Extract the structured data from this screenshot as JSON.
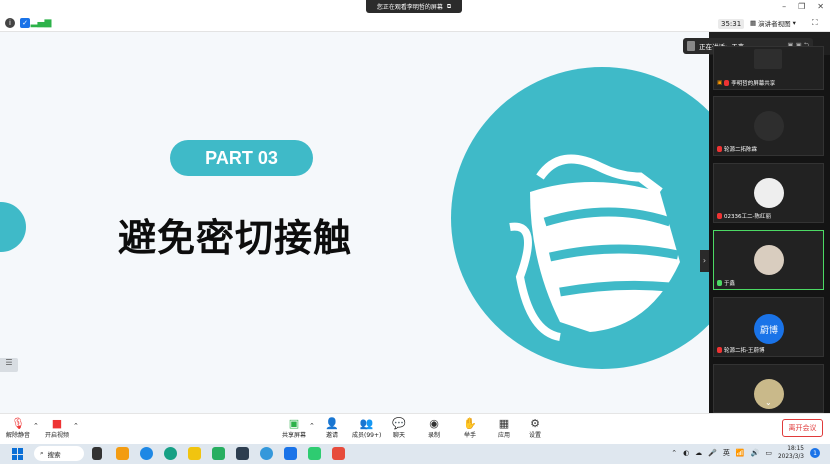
{
  "banner": {
    "text": "您正在观看李明哲的屏幕",
    "icon": "window-icon"
  },
  "topbar": {
    "timer": "35:31",
    "view_label": "演讲者视图"
  },
  "slide": {
    "part": "PART 03",
    "title": "避免密切接触"
  },
  "speaker": {
    "label": "正在讲话:",
    "name": "于鑫"
  },
  "gallery": [
    {
      "name": "李明哲的屏幕共享",
      "type": "share"
    },
    {
      "name": "轮源二拓陈霖",
      "type": "dark"
    },
    {
      "name": "02336工二-陈红丽",
      "type": "photo"
    },
    {
      "name": "于鑫",
      "type": "face",
      "speaking": true
    },
    {
      "name": "轮源二拓-王蔚博",
      "type": "initial",
      "initial": "蔚博"
    },
    {
      "name": "",
      "type": "photo"
    }
  ],
  "toolbar": {
    "mute": "解除静音",
    "video": "开启视频",
    "share": "共享屏幕",
    "invite": "邀请",
    "members": "成员(99+)",
    "chat": "聊天",
    "record": "录制",
    "raise": "举手",
    "apps": "应用",
    "settings": "设置",
    "leave": "离开会议"
  },
  "taskbar": {
    "search": "搜索",
    "ime": "英",
    "time": "18:15",
    "date": "2023/3/3",
    "notifications": "1"
  },
  "colors": {
    "accent": "#3fbac8",
    "leave": "#e03b3b",
    "speaking": "#4cd964"
  }
}
